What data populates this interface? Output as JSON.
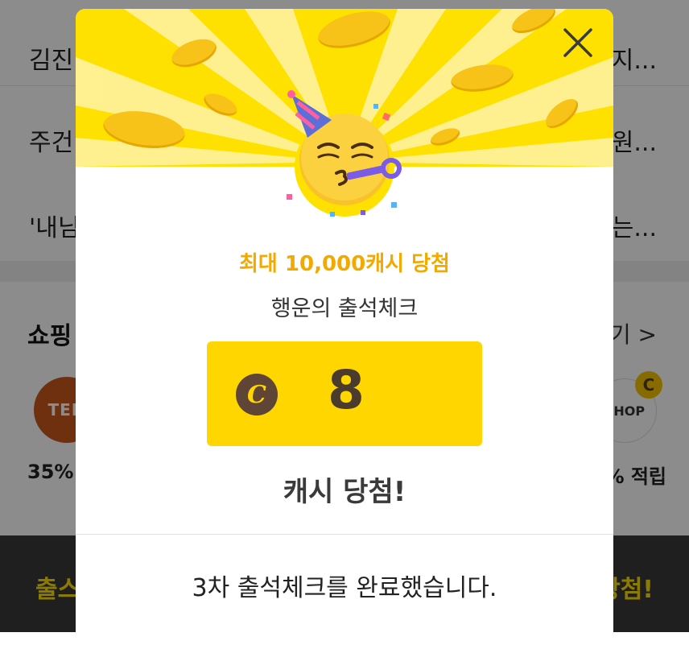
{
  "background": {
    "news": [
      {
        "left": "김진",
        "right": "지..."
      },
      {
        "left": "주건",
        "right": "원..."
      },
      {
        "left": "'내님",
        "right": "는..."
      }
    ],
    "shopping": {
      "title": "쇼핑",
      "more": "기 >",
      "left_logo": "TEN",
      "right_logo": "SHOP",
      "right_badge": "C",
      "left_pct": "35%",
      "right_pct": "% 적립"
    },
    "bottom_bar": {
      "left": "출스",
      "right": "당첨!"
    }
  },
  "modal": {
    "subtitle": "최대 10,000캐시 당첨",
    "event_name": "행운의 출석체크",
    "cash_symbol": "C",
    "cash_amount": "8",
    "win_text": "캐시 당첨!",
    "complete_text": "3차 출석체크를 완료했습니다.",
    "icons": {
      "close": "close-icon",
      "emoji": "partying-face-icon",
      "coin": "cash-coin-icon"
    }
  },
  "colors": {
    "hero_yellow": "#ffe100",
    "cash_box": "#ffd600",
    "subtitle_orange": "#f2a900",
    "coin_brown": "#5e4535"
  }
}
